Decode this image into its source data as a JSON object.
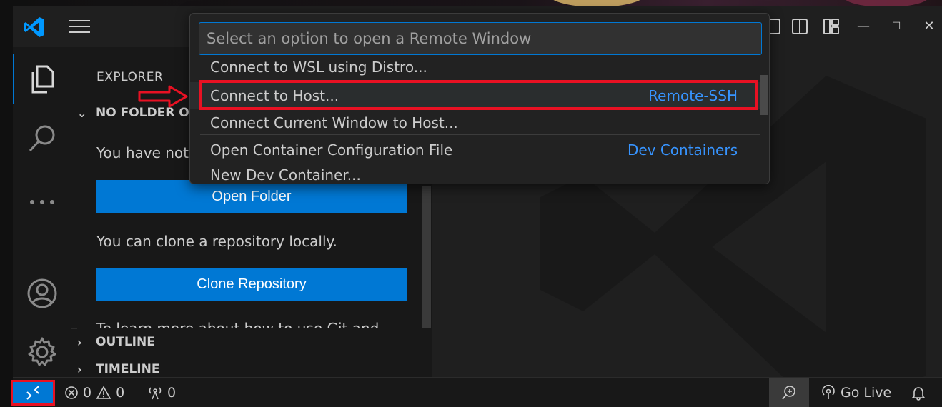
{
  "titlebar": {
    "app_icon": "vscode-logo-icon",
    "menu_icon": "hamburger-menu-icon",
    "layout_icons": [
      "toggle-primary-sidebar-icon",
      "toggle-secondary-sidebar-icon",
      "customize-layout-icon"
    ],
    "window_controls": {
      "minimize": "—",
      "maximize": "☐",
      "close": "✕"
    }
  },
  "activity_bar": {
    "items": [
      "explorer-icon",
      "search-icon",
      "more-icon"
    ],
    "bottom": [
      "accounts-icon",
      "manage-gear-icon"
    ]
  },
  "sidebar": {
    "title": "EXPLORER",
    "section_no_folder": "NO FOLDER OPENED",
    "text_no_folder": "You have not yet opened a folder.",
    "open_folder_label": "Open Folder",
    "text_clone": "You can clone a repository locally.",
    "clone_label": "Clone Repository",
    "text_learn": "To learn more about how to use Git and",
    "outline_label": "OUTLINE",
    "timeline_label": "TIMELINE"
  },
  "quick_pick": {
    "placeholder": "Select an option to open a Remote Window",
    "items": [
      {
        "label": "Connect to WSL using Distro...",
        "detail": ""
      },
      {
        "label": "Connect to Host...",
        "detail": "Remote-SSH"
      },
      {
        "label": "Connect Current Window to Host...",
        "detail": ""
      },
      {
        "label": "Open Container Configuration File",
        "detail": "Dev Containers"
      },
      {
        "label": "New Dev Container...",
        "detail": ""
      }
    ]
  },
  "statusbar": {
    "remote_icon": "remote-indicator-icon",
    "errors": "0",
    "warnings": "0",
    "ports": "0",
    "go_live": "Go Live",
    "zoom_icon": "zoom-in-icon",
    "bell_icon": "notifications-bell-icon"
  },
  "colors": {
    "accent": "#0078d4",
    "highlight_annotation": "#e81123",
    "detail_link": "#3794ff"
  }
}
